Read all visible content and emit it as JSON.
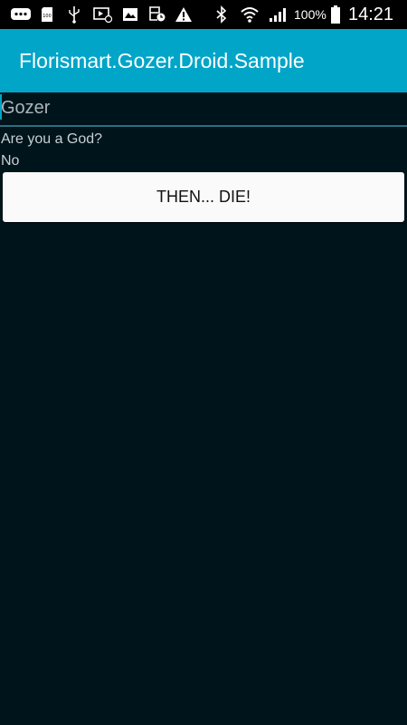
{
  "status_bar": {
    "icons": [
      "messages-icon",
      "sim-card-icon",
      "usb-icon",
      "screen-mirroring-icon",
      "gallery-icon",
      "clock-notification-icon",
      "warning-icon",
      "bluetooth-icon",
      "wifi-icon",
      "signal-icon",
      "battery-icon"
    ],
    "battery_percent": "100%",
    "time": "14:21"
  },
  "app_bar": {
    "title": "Florismart.Gozer.Droid.Sample",
    "color": "#00a5c8"
  },
  "form": {
    "entry_value": "Gozer",
    "question": "Are you a God?",
    "answer": "No",
    "button_label": "THEN... DIE!"
  },
  "colors": {
    "background": "#00141c",
    "accent": "#00a5c8",
    "button": "#fafafa"
  }
}
